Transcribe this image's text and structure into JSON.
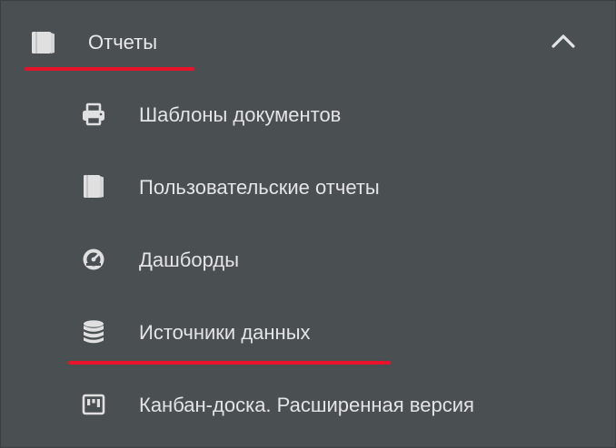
{
  "section": {
    "title": "Отчеты",
    "icon": "report-book-icon",
    "expanded": true,
    "chevron_icon": "chevron-up-icon"
  },
  "items": [
    {
      "label": "Шаблоны документов",
      "icon": "printer-icon"
    },
    {
      "label": "Пользовательские отчеты",
      "icon": "report-book-icon"
    },
    {
      "label": "Дашборды",
      "icon": "dashboard-gauge-icon"
    },
    {
      "label": "Источники данных",
      "icon": "database-icon",
      "active": true
    },
    {
      "label": "Канбан-доска. Расширенная версия",
      "icon": "kanban-board-icon"
    }
  ],
  "colors": {
    "background": "#4a4f52",
    "text": "#e4e4e4",
    "icon": "#e0e0e0",
    "accent_underline": "#e8132a"
  }
}
